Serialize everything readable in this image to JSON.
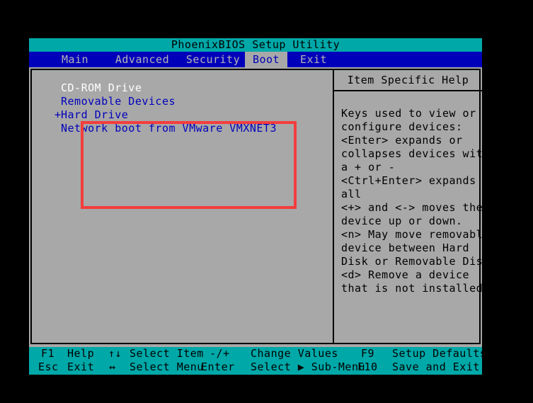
{
  "title_bar": {
    "text": "PhoenixBIOS Setup Utility"
  },
  "menu": {
    "tabs": [
      {
        "label": "Main",
        "active": false
      },
      {
        "label": "Advanced",
        "active": false
      },
      {
        "label": "Security",
        "active": false
      },
      {
        "label": "Boot",
        "active": true
      },
      {
        "label": "Exit",
        "active": false
      }
    ]
  },
  "boot_order": {
    "items": [
      {
        "marker": "",
        "label": "CD-ROM Drive",
        "selected": true
      },
      {
        "marker": "",
        "label": "Removable Devices",
        "selected": false
      },
      {
        "marker": "+",
        "label": "Hard Drive",
        "selected": false
      },
      {
        "marker": "",
        "label": "Network boot from VMware VMXNET3",
        "selected": false
      }
    ]
  },
  "annotation": {
    "color": "#f43d3d"
  },
  "help": {
    "title": "Item Specific Help",
    "lines": [
      "Keys used to view or",
      "configure devices:",
      "<Enter> expands or",
      "collapses devices with",
      "a + or -",
      "<Ctrl+Enter> expands",
      "all",
      "<+> and <-> moves the",
      "device up or down.",
      "<n> May move removable",
      "device between Hard",
      "Disk or Removable Disk",
      "<d> Remove a device",
      "that is not installed."
    ]
  },
  "footer": {
    "row1": [
      {
        "key": "F1",
        "action": "Help"
      },
      {
        "key": "↑↓",
        "action": "Select Item"
      },
      {
        "key": "-/+",
        "action": "Change Values"
      },
      {
        "key": "F9",
        "action": "Setup Defaults"
      }
    ],
    "row2": [
      {
        "key": "Esc",
        "action": "Exit"
      },
      {
        "key": "↔",
        "action": "Select Menu"
      },
      {
        "key": "Enter",
        "action": "Select ▶ Sub-Menu"
      },
      {
        "key": "F10",
        "action": "Save and Exit"
      }
    ]
  },
  "colors": {
    "teal": "#00a8a8",
    "blue": "#0000bb",
    "gray": "#a8a8a8",
    "white": "#ffffff",
    "black": "#000000",
    "annotation_red": "#f43d3d"
  }
}
